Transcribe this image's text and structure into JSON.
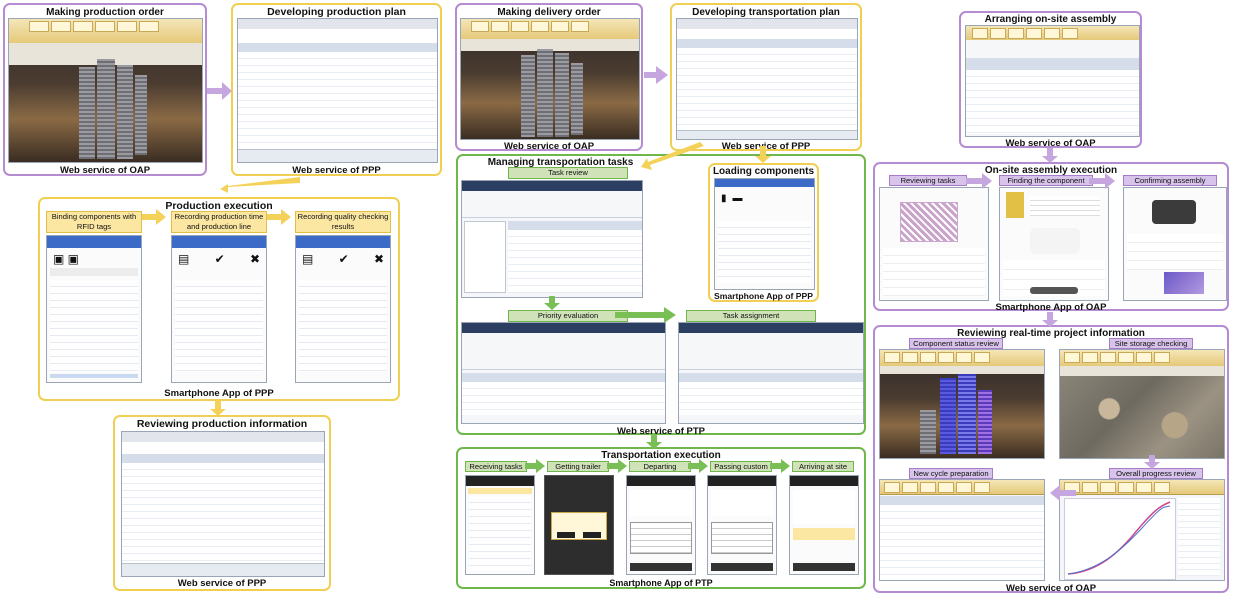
{
  "p1": {
    "title": "Making production order",
    "caption": "Web service of OAP"
  },
  "p2": {
    "title": "Developing production plan",
    "caption": "Web service of PPP"
  },
  "p3": {
    "title": "Production execution",
    "sub": [
      "Binding components with RFID tags",
      "Recording production time and production line",
      "Recording quality checking results"
    ],
    "caption": "Smartphone App of PPP"
  },
  "p4": {
    "title": "Reviewing production information",
    "caption": "Web service of PPP"
  },
  "p5": {
    "title": "Making delivery order",
    "caption": "Web service of OAP"
  },
  "p6": {
    "title": "Developing transportation plan",
    "caption": "Web service of PPP"
  },
  "p7": {
    "title": "Managing transportation tasks",
    "task_review": "Task review",
    "priority": "Priority evaluation",
    "assignment": "Task assignment",
    "caption": "Web service of PTP"
  },
  "p8": {
    "title": "Loading components",
    "caption": "Smartphone App of PPP"
  },
  "p9": {
    "title": "Transportation execution",
    "steps": [
      "Receiving tasks",
      "Getting trailer",
      "Departing",
      "Passing custom",
      "Arriving at site"
    ],
    "caption": "Smartphone App of PTP"
  },
  "p10": {
    "title": "Arranging on-site assembly",
    "caption": "Web service of OAP"
  },
  "p11": {
    "title": "On-site assembly execution",
    "steps": [
      "Reviewing tasks",
      "Finding the component",
      "Confirming assembly"
    ],
    "caption": "Smartphone App of OAP"
  },
  "p12": {
    "title": "Reviewing real-time project information",
    "sub": [
      "Component status review",
      "Site storage checking",
      "New cycle preparation",
      "Overall progress review"
    ],
    "caption": "Web service of OAP"
  },
  "colors": {
    "purple": "#b58bd1",
    "yellow": "#f0cf52",
    "green": "#6fb74b",
    "arrowPurple": "#c6a6de",
    "arrowYellow": "#f4d25a",
    "arrowGreen": "#79bf55"
  }
}
